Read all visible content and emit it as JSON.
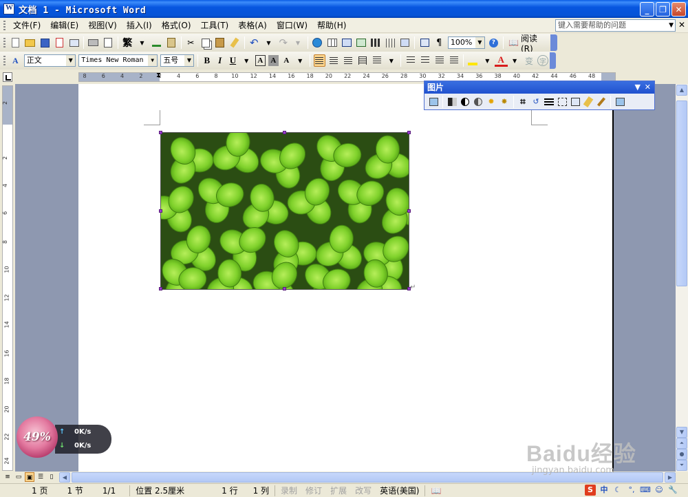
{
  "window": {
    "title": "文档 1 - Microsoft Word"
  },
  "menu": {
    "items": [
      "文件(F)",
      "编辑(E)",
      "视图(V)",
      "插入(I)",
      "格式(O)",
      "工具(T)",
      "表格(A)",
      "窗口(W)",
      "帮助(H)"
    ],
    "help_placeholder": "键入需要帮助的问题"
  },
  "standard_toolbar": {
    "zoom": "100%",
    "read_label": "阅读(R)",
    "trad_label": "繁"
  },
  "format_toolbar": {
    "style": "正文",
    "font": "Times New Roman",
    "size": "五号",
    "bold": "B",
    "italic": "I",
    "underline": "U",
    "border_char": "A",
    "shade_char": "A",
    "scale_char": "A",
    "font_color_char": "A",
    "phonetic_char": "变",
    "enclose_char": "字"
  },
  "ruler": {
    "labels": [
      "8",
      "6",
      "4",
      "2",
      "2",
      "4",
      "6",
      "8",
      "10",
      "12",
      "14",
      "16",
      "18",
      "20",
      "22",
      "24",
      "26",
      "28",
      "30",
      "32",
      "34",
      "36",
      "38",
      "40",
      "42",
      "44",
      "46",
      "48"
    ],
    "vlabels": [
      "2",
      "2",
      "4",
      "6",
      "8",
      "10",
      "12",
      "14",
      "16",
      "18",
      "20",
      "22",
      "24"
    ]
  },
  "picture_toolbar": {
    "title": "图片"
  },
  "status": {
    "page": "1 页",
    "section": "1 节",
    "pages": "1/1",
    "position": "位置 2.5厘米",
    "line": "1 行",
    "column": "1 列",
    "rec": "录制",
    "trk": "修订",
    "ext": "扩展",
    "ovr": "改写",
    "language": "英语(美国)"
  },
  "network_monitor": {
    "percent": "49%",
    "up": "0K/s",
    "down": "0K/s"
  },
  "watermark": {
    "main": "Baidu经验",
    "sub": "jingyan.baidu.com"
  },
  "tray": {
    "ime": "中"
  },
  "colors": {
    "titlebar": "#0756e0",
    "page": "#ffffff",
    "doc_bg": "#8e98b0",
    "clover": "#7ccf2a"
  }
}
